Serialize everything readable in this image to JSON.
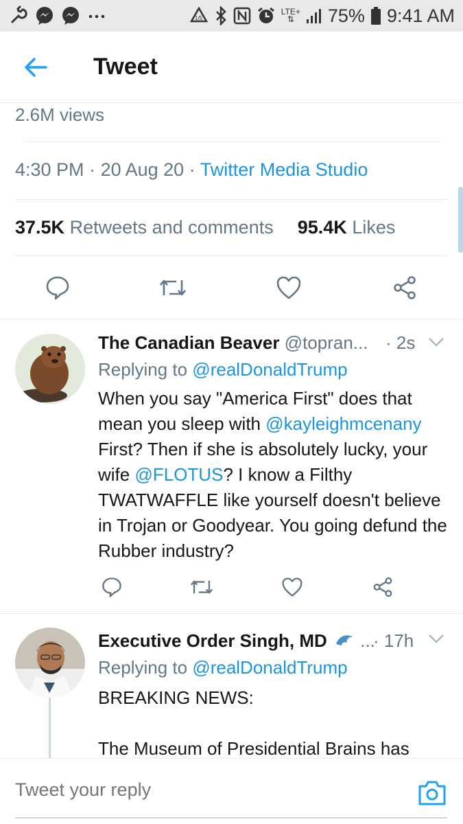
{
  "status_bar": {
    "battery": "75%",
    "time": "9:41 AM",
    "network": "LTE+",
    "icons_left": [
      "wrench-icon",
      "messenger-icon",
      "messenger-icon",
      "more-dots-icon"
    ],
    "icons_right": [
      "recycle-icon",
      "bluetooth-icon",
      "nfc-icon",
      "alarm-icon",
      "lte-icon",
      "signal-icon",
      "battery-icon"
    ]
  },
  "header": {
    "title": "Tweet"
  },
  "tweet": {
    "views": "2.6M views",
    "time": "4:30 PM",
    "date": "20 Aug 20",
    "source": "Twitter Media Studio",
    "retweets_count": "37.5K",
    "retweets_label": "Retweets and comments",
    "likes_count": "95.4K",
    "likes_label": "Likes"
  },
  "replies": [
    {
      "name": "The Canadian Beaver",
      "handle": "@topran...",
      "time": "· 2s",
      "replying_prefix": "Replying to",
      "replying_to": "@realDonaldTrump",
      "body_parts": [
        "When you say \"America First\" does that mean you sleep with ",
        "@kayleighmcenany",
        " First? Then if she is absolutely lucky, your wife ",
        "@FLOTUS",
        "? I know a Filthy TWATWAFFLE like yourself doesn't believe in Trojan or Goodyear. You going defund the Rubber industry?"
      ]
    },
    {
      "name": "Executive Order Singh, MD",
      "handle": "...",
      "time": "· 17h",
      "replying_prefix": "Replying to",
      "replying_to": "@realDonaldTrump",
      "body_line1": "BREAKING NEWS:",
      "body_line2": "The Museum of Presidential Brains has"
    }
  ],
  "reply_bar": {
    "placeholder": "Tweet your reply"
  },
  "colors": {
    "link": "#1b95e0",
    "muted": "#657786",
    "text": "#14171a",
    "status_bg": "#e9e9e9"
  }
}
